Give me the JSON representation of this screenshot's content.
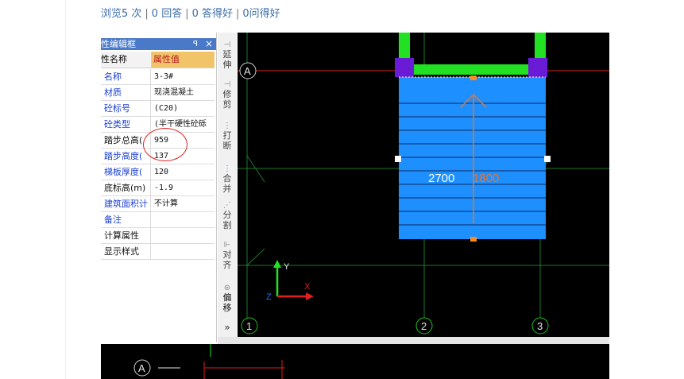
{
  "stats": {
    "views": "浏览5 次",
    "answers": "0 回答",
    "answer_likes": "0 答得好",
    "question_likes": "0问得好",
    "separator": "|"
  },
  "panel": {
    "title": "性编辑框",
    "pin": "ꟼ",
    "close": "×",
    "header_name": "性名称",
    "header_value": "属性值",
    "rows": [
      {
        "name": "名称",
        "value": "3-3#"
      },
      {
        "name": "材质",
        "value": "现浇混凝土"
      },
      {
        "name": "砼标号",
        "value": "(C20)"
      },
      {
        "name": "砼类型",
        "value": "(半干硬性砼砾"
      },
      {
        "name": "踏步总高(",
        "value": "959"
      },
      {
        "name": "踏步高度(",
        "value": "137"
      },
      {
        "name": "梯板厚度(",
        "value": "120"
      },
      {
        "name": "底标高(m)",
        "value": "-1.9"
      },
      {
        "name": "建筑面积计",
        "value": "不计算"
      },
      {
        "name": "备注",
        "value": ""
      },
      {
        "name": "计算属性",
        "value": ""
      },
      {
        "name": "显示样式",
        "value": ""
      }
    ]
  },
  "toolbar": {
    "items": [
      {
        "label": "延伸",
        "icon": "extend-icon"
      },
      {
        "label": "修剪",
        "icon": "trim-icon"
      },
      {
        "label": "打断",
        "icon": "break-icon"
      },
      {
        "label": "合并",
        "icon": "merge-icon"
      },
      {
        "label": "分割",
        "icon": "split-icon"
      },
      {
        "label": "对齐",
        "icon": "align-icon"
      },
      {
        "label": "偏移",
        "icon": "offset-icon"
      }
    ],
    "more": "»"
  },
  "cad": {
    "axis_labels": {
      "row_a": "A",
      "col_1": "1",
      "col_2": "2",
      "col_3": "3"
    },
    "dim_left": "2700",
    "dim_right": "1800",
    "ucs": {
      "x": "X",
      "y": "Y",
      "z": "Z"
    },
    "bottom_axis": "A",
    "colors": {
      "stair": "#1e8fff",
      "column": "#6a1bd6",
      "beam": "#22e022",
      "grid": "#1c7a2a",
      "axis_red": "#d81e1e"
    }
  }
}
